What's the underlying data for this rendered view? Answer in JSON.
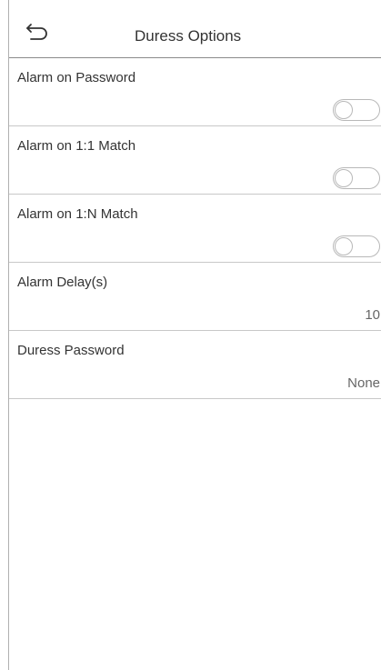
{
  "header": {
    "title": "Duress Options",
    "back_icon": "back-arrow-icon"
  },
  "settings": [
    {
      "label": "Alarm on Password",
      "type": "toggle",
      "enabled": false
    },
    {
      "label": "Alarm on 1:1 Match",
      "type": "toggle",
      "enabled": false
    },
    {
      "label": "Alarm on 1:N Match",
      "type": "toggle",
      "enabled": false
    },
    {
      "label": "Alarm Delay(s)",
      "type": "value",
      "value": "10"
    },
    {
      "label": "Duress Password",
      "type": "value",
      "value": "None"
    }
  ]
}
